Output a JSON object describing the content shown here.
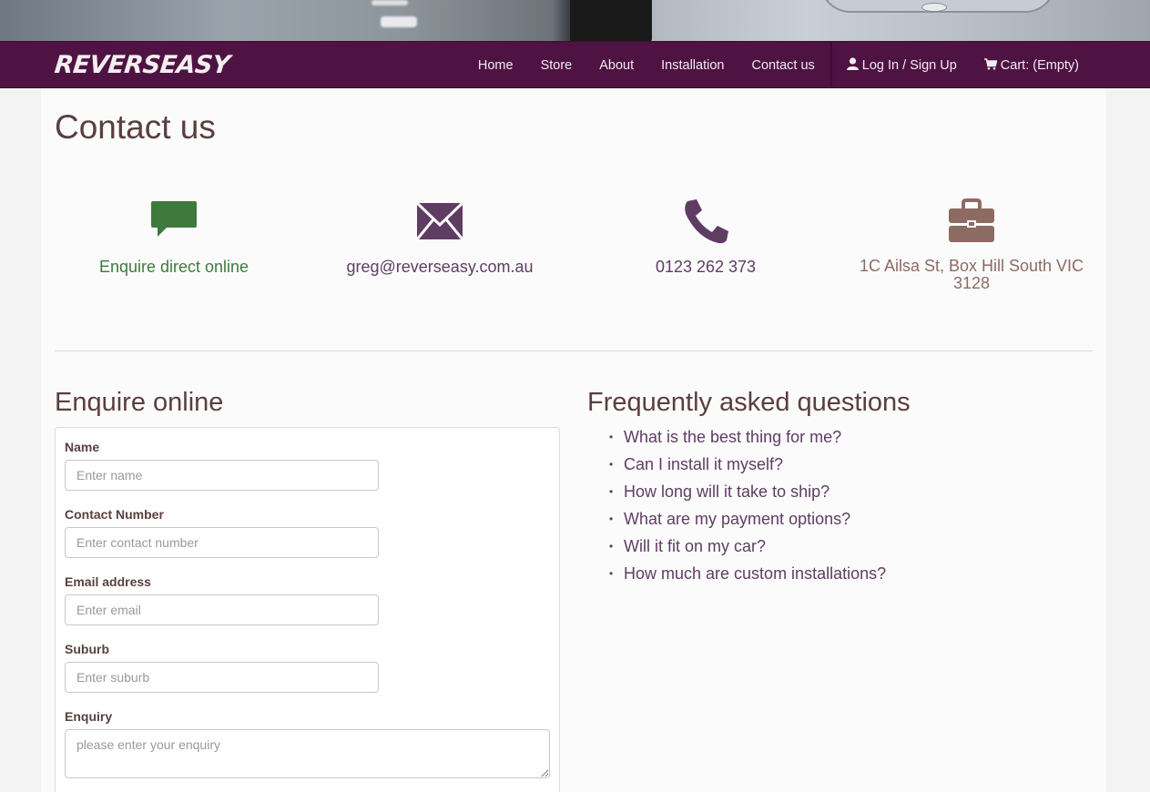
{
  "brand": "REVERSEASY",
  "nav": {
    "items": [
      "Home",
      "Store",
      "About",
      "Installation",
      "Contact us"
    ],
    "login": "Log In / Sign Up",
    "cart": "Cart: (Empty)"
  },
  "page_title": "Contact us",
  "contacts": [
    {
      "label": "Enquire direct online",
      "icon": "speech-bubble-icon"
    },
    {
      "label": "greg@reverseasy.com.au",
      "icon": "envelope-icon"
    },
    {
      "label": "0123 262 373",
      "icon": "phone-icon"
    },
    {
      "label": "1C Ailsa St, Box Hill South VIC 3128",
      "icon": "briefcase-icon"
    }
  ],
  "enquire": {
    "title": "Enquire online",
    "fields": [
      {
        "label": "Name",
        "placeholder": "Enter name"
      },
      {
        "label": "Contact Number",
        "placeholder": "Enter contact number"
      },
      {
        "label": "Email address",
        "placeholder": "Enter email"
      },
      {
        "label": "Suburb",
        "placeholder": "Enter suburb"
      }
    ],
    "enquiry_label": "Enquiry",
    "enquiry_placeholder": "please enter your enquiry"
  },
  "faq": {
    "title": "Frequently asked questions",
    "items": [
      "What is the best thing for me?",
      "Can I install it myself?",
      "How long will it take to ship?",
      "What are my payment options?",
      "Will it fit on my car?",
      "How much are custom installations?"
    ]
  },
  "colors": {
    "navbar": "#4e1342",
    "green": "#3e7a3c",
    "purple": "#5f3d63",
    "brown": "#8d6b63",
    "text": "#5a3f3f"
  }
}
